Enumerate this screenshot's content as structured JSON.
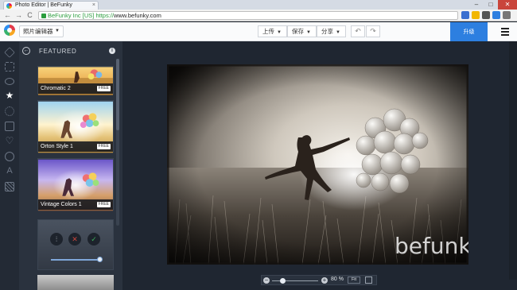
{
  "browser": {
    "tab_title": "Photo Editor | BeFunky",
    "tab_close": "×",
    "window_controls": {
      "minimize": "–",
      "maximize": "□",
      "close": "✕"
    },
    "nav": {
      "back": "←",
      "forward": "→",
      "reload": "C"
    },
    "address": {
      "ev_label": "BeFunky Inc [US]",
      "protocol": "https://",
      "host": "www.befunky.com"
    },
    "extensions": [
      "shield-icon",
      "star-icon",
      "extension-icon",
      "account-icon",
      "menu-icon"
    ]
  },
  "toolbar": {
    "mode_label": "照片编辑器",
    "open_label": "上传",
    "save_label": "保存",
    "share_label": "分享",
    "undo_glyph": "↶",
    "redo_glyph": "↷",
    "upgrade_label": "升级",
    "dropdown_glyph": "▼"
  },
  "rail_icons": [
    "layers-icon",
    "adjust-icon",
    "eye-icon",
    "star-icon",
    "frame-icon",
    "square-icon",
    "heart-icon",
    "circle-icon",
    "text-icon",
    "texture-icon"
  ],
  "panel": {
    "title": "FEATURED",
    "back_glyph": "←",
    "info_glyph": "i",
    "cards": [
      {
        "label": "Chromatic 2",
        "badge": "FREE"
      },
      {
        "label": "Orton Style 1",
        "badge": "FREE"
      },
      {
        "label": "Vintage Colors 1",
        "badge": "FREE"
      }
    ],
    "adjust": {
      "settings_glyph": "⫶",
      "cancel_glyph": "✕",
      "apply_glyph": "✓",
      "slider_fraction": 0.95
    }
  },
  "canvas": {
    "watermark": "befunky"
  },
  "zoom": {
    "minus": "−",
    "plus": "+",
    "value": "80 %",
    "fit_label": "Fit",
    "slider_fraction": 0.25
  },
  "colors": {
    "accent": "#2d7fe0",
    "panel_bg": "#2a323e",
    "canvas_bg": "#1f2631",
    "cancel": "#c9453b",
    "apply": "#3cae5a"
  }
}
